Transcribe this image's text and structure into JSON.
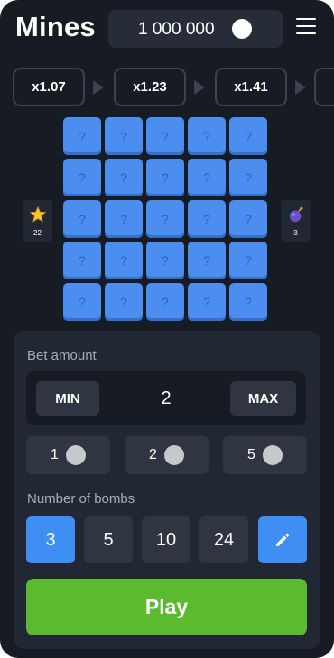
{
  "header": {
    "title": "Mines",
    "balance": "1 000 000",
    "coin_icon": "coin-icon",
    "menu_icon": "hamburger-menu-icon"
  },
  "multipliers": [
    "x1.07",
    "x1.23",
    "x1.41",
    ""
  ],
  "grid": {
    "rows": 5,
    "cols": 5,
    "cell_symbol": "?",
    "cell_color": "#4c8df0"
  },
  "side": {
    "stars_icon": "star-icon",
    "stars_count": "22",
    "bombs_icon": "bomb-icon",
    "bombs_count": "3"
  },
  "bet": {
    "label": "Bet amount",
    "min_label": "MIN",
    "max_label": "MAX",
    "value": "2",
    "quick_amounts": [
      "1",
      "2",
      "5"
    ],
    "quick_icon": "chip-icon"
  },
  "bombs": {
    "label": "Number of bombs",
    "options": [
      "3",
      "5",
      "10",
      "24"
    ],
    "selected": "3",
    "edit_icon": "pencil-icon"
  },
  "play": {
    "label": "Play"
  },
  "colors": {
    "background": "#161b24",
    "panel": "#222833",
    "accent_blue": "#3f8ef3",
    "play_green": "#5bba2f"
  }
}
